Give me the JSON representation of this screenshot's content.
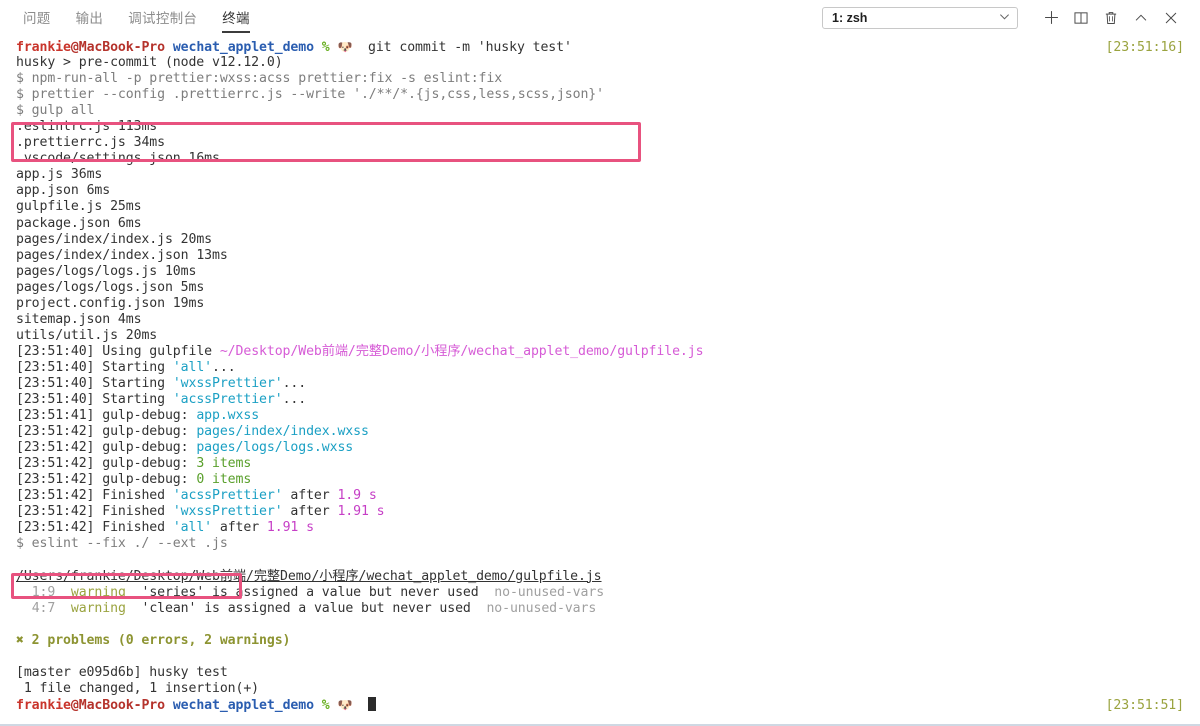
{
  "panel": {
    "tabs": [
      {
        "label": "问题",
        "active": false
      },
      {
        "label": "输出",
        "active": false
      },
      {
        "label": "调试控制台",
        "active": false
      },
      {
        "label": "终端",
        "active": true
      }
    ],
    "terminal_select": {
      "value": "1: zsh",
      "chevron": "chevron-down-icon"
    },
    "toolbar_buttons": [
      {
        "name": "new-terminal-button",
        "icon": "plus-icon",
        "title": "新建终端"
      },
      {
        "name": "split-terminal-button",
        "icon": "split-panel-icon",
        "title": "拆分终端"
      },
      {
        "name": "kill-terminal-button",
        "icon": "trash-icon",
        "title": "终止终端"
      },
      {
        "name": "maximize-panel-button",
        "icon": "chevron-up-icon",
        "title": "最大化面板"
      },
      {
        "name": "close-panel-button",
        "icon": "close-icon",
        "title": "关闭面板"
      }
    ]
  },
  "terminal": {
    "prompt": {
      "user": "frankie",
      "host": "@MacBook-Pro",
      "dir": "wechat_applet_demo",
      "pct": "%",
      "emoji": "🐶"
    },
    "timestamp_top": "[23:51:16]",
    "timestamp_bottom": "[23:51:51]",
    "command_first": "git commit -m 'husky test'",
    "lines": [
      "husky > pre-commit (node v12.12.0)",
      "$ npm-run-all -p prettier:wxss:acss prettier:fix -s eslint:fix",
      "$ prettier --config .prettierrc.js --write './**/*.{js,css,less,scss,json}'",
      "$ gulp all"
    ],
    "prettier_files": [
      {
        "file": ".eslintrc.js",
        "time": "113ms"
      },
      {
        "file": ".prettierrc.js",
        "time": "34ms"
      },
      {
        "file": ".vscode/settings.json",
        "time": "16ms"
      },
      {
        "file": "app.js",
        "time": "36ms"
      },
      {
        "file": "app.json",
        "time": "6ms"
      },
      {
        "file": "gulpfile.js",
        "time": "25ms"
      },
      {
        "file": "package.json",
        "time": "6ms"
      },
      {
        "file": "pages/index/index.js",
        "time": "20ms"
      },
      {
        "file": "pages/index/index.json",
        "time": "13ms"
      },
      {
        "file": "pages/logs/logs.js",
        "time": "10ms"
      },
      {
        "file": "pages/logs/logs.json",
        "time": "5ms"
      },
      {
        "file": "project.config.json",
        "time": "19ms"
      },
      {
        "file": "sitemap.json",
        "time": "4ms"
      },
      {
        "file": "utils/util.js",
        "time": "20ms"
      }
    ],
    "gulp_using": {
      "time": "[23:51:40]",
      "text": "Using gulpfile ",
      "path": "~/Desktop/Web前端/完整Demo/小程序/wechat_applet_demo/gulpfile.js"
    },
    "gulp_starting": [
      {
        "time": "[23:51:40]",
        "verb": "Starting ",
        "task": "'all'",
        "suffix": "..."
      },
      {
        "time": "[23:51:40]",
        "verb": "Starting ",
        "task": "'wxssPrettier'",
        "suffix": "..."
      },
      {
        "time": "[23:51:40]",
        "verb": "Starting ",
        "task": "'acssPrettier'",
        "suffix": "..."
      }
    ],
    "gulp_debug": [
      {
        "time": "[23:51:41]",
        "label": "gulp-debug: ",
        "value": "app.wxss",
        "color": "cyan"
      },
      {
        "time": "[23:51:42]",
        "label": "gulp-debug: ",
        "value": "pages/index/index.wxss",
        "color": "cyan"
      },
      {
        "time": "[23:51:42]",
        "label": "gulp-debug: ",
        "value": "pages/logs/logs.wxss",
        "color": "cyan"
      },
      {
        "time": "[23:51:42]",
        "label": "gulp-debug: ",
        "value": "3 items",
        "color": "green"
      },
      {
        "time": "[23:51:42]",
        "label": "gulp-debug: ",
        "value": "0 items",
        "color": "green"
      }
    ],
    "gulp_finished": [
      {
        "time": "[23:51:42]",
        "verb": "Finished ",
        "task": "'acssPrettier'",
        "mid": " after ",
        "dur": "1.9 s"
      },
      {
        "time": "[23:51:42]",
        "verb": "Finished ",
        "task": "'wxssPrettier'",
        "mid": " after ",
        "dur": "1.91 s"
      },
      {
        "time": "[23:51:42]",
        "verb": "Finished ",
        "task": "'all'",
        "mid": " after ",
        "dur": "1.91 s"
      }
    ],
    "eslint_command": "$ eslint --fix ./ --ext .js",
    "eslint_file": "/Users/frankie/Desktop/Web前端/完整Demo/小程序/wechat_applet_demo/gulpfile.js",
    "eslint_warnings": [
      {
        "loc": "1:9",
        "severity": "warning",
        "message": "'series' is assigned a value but never used",
        "rule": "no-unused-vars"
      },
      {
        "loc": "4:7",
        "severity": "warning",
        "message": "'clean' is assigned a value but never used",
        "rule": "no-unused-vars"
      }
    ],
    "eslint_summary": "✖ 2 problems (0 errors, 2 warnings)",
    "git_result": [
      "[master e095d6b] husky test",
      " 1 file changed, 1 insertion(+)"
    ]
  },
  "highlights": [
    {
      "name": "prettier-command-highlight",
      "color": "#e8527f"
    },
    {
      "name": "eslint-command-highlight",
      "color": "#e8527f"
    }
  ]
}
